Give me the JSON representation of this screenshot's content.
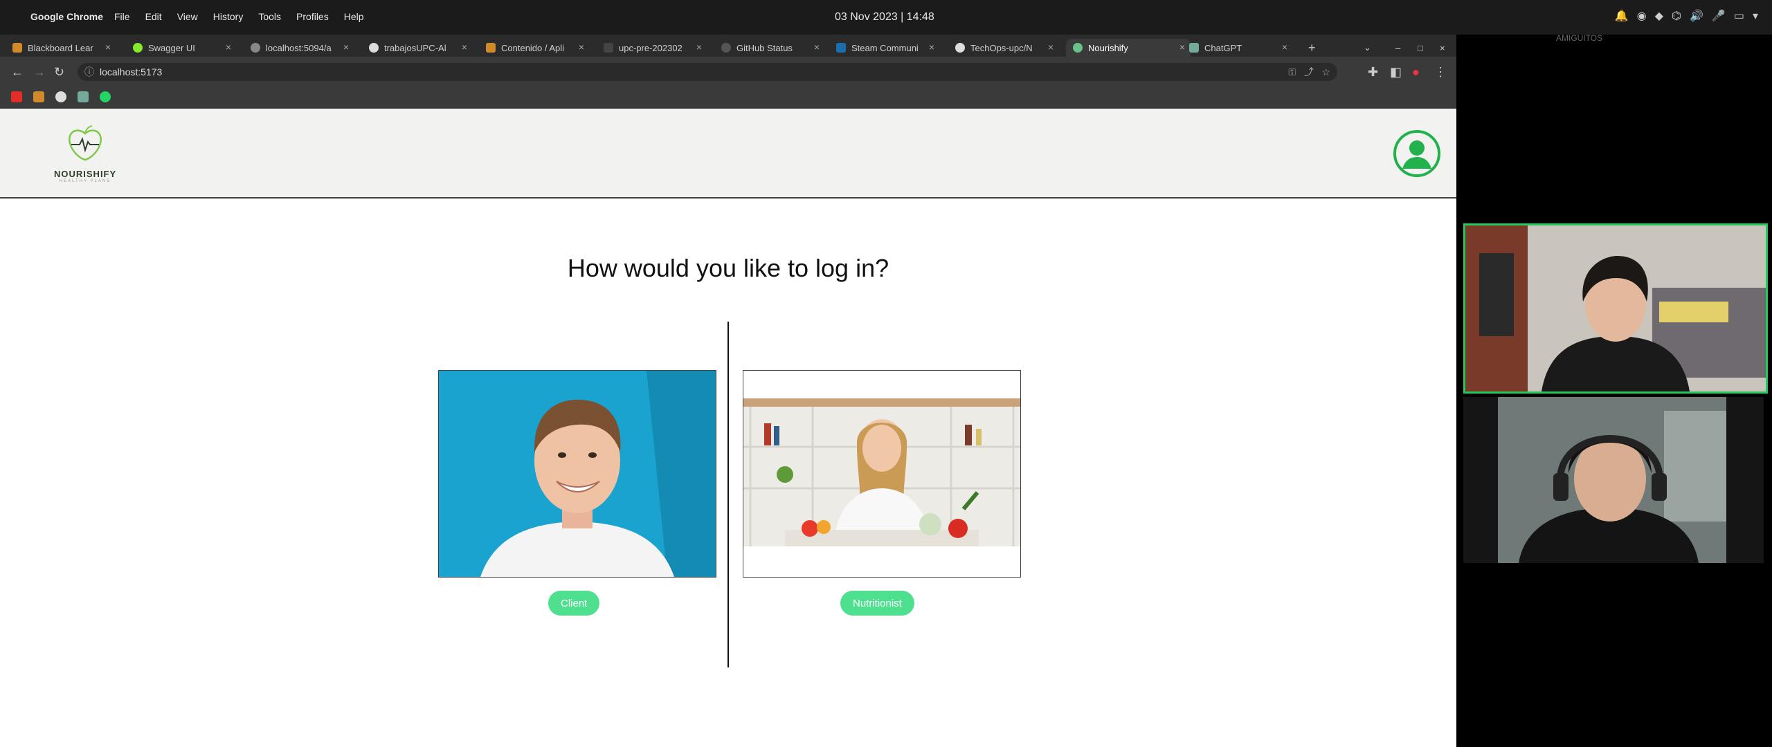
{
  "system": {
    "app_name": "Google Chrome",
    "menu": [
      "File",
      "Edit",
      "View",
      "History",
      "Tools",
      "Profiles",
      "Help"
    ],
    "clock": "03 Nov 2023 | 14:48"
  },
  "tabs": [
    {
      "label": "Blackboard Lear",
      "color": "#d08a2c"
    },
    {
      "label": "Swagger UI",
      "color": "#85ea2d"
    },
    {
      "label": "localhost:5094/a",
      "color": "#888888"
    },
    {
      "label": "trabajosUPC-Al",
      "color": "#dddddd"
    },
    {
      "label": "Contenido / Apli",
      "color": "#d08a2c"
    },
    {
      "label": "upc-pre-202302",
      "color": "#444444"
    },
    {
      "label": "GitHub Status",
      "color": "#555555"
    },
    {
      "label": "Steam Communi",
      "color": "#1b6fb0"
    },
    {
      "label": "TechOps-upc/N",
      "color": "#dddddd"
    },
    {
      "label": "Nourishify",
      "color": "#6ac28a"
    },
    {
      "label": "ChatGPT",
      "color": "#74aa9c"
    }
  ],
  "address": {
    "url": "localhost:5173"
  },
  "page": {
    "brand": "NOURISHIFY",
    "tagline": "HEALTHY PLANS",
    "question": "How would you like to log in?",
    "client_label": "Client",
    "nutritionist_label": "Nutritionist"
  },
  "colors": {
    "accent": "#4fe08f",
    "avatar": "#22b14c",
    "pip_active": "#25c95a"
  },
  "call": {
    "room": "AMIGUITOS"
  }
}
